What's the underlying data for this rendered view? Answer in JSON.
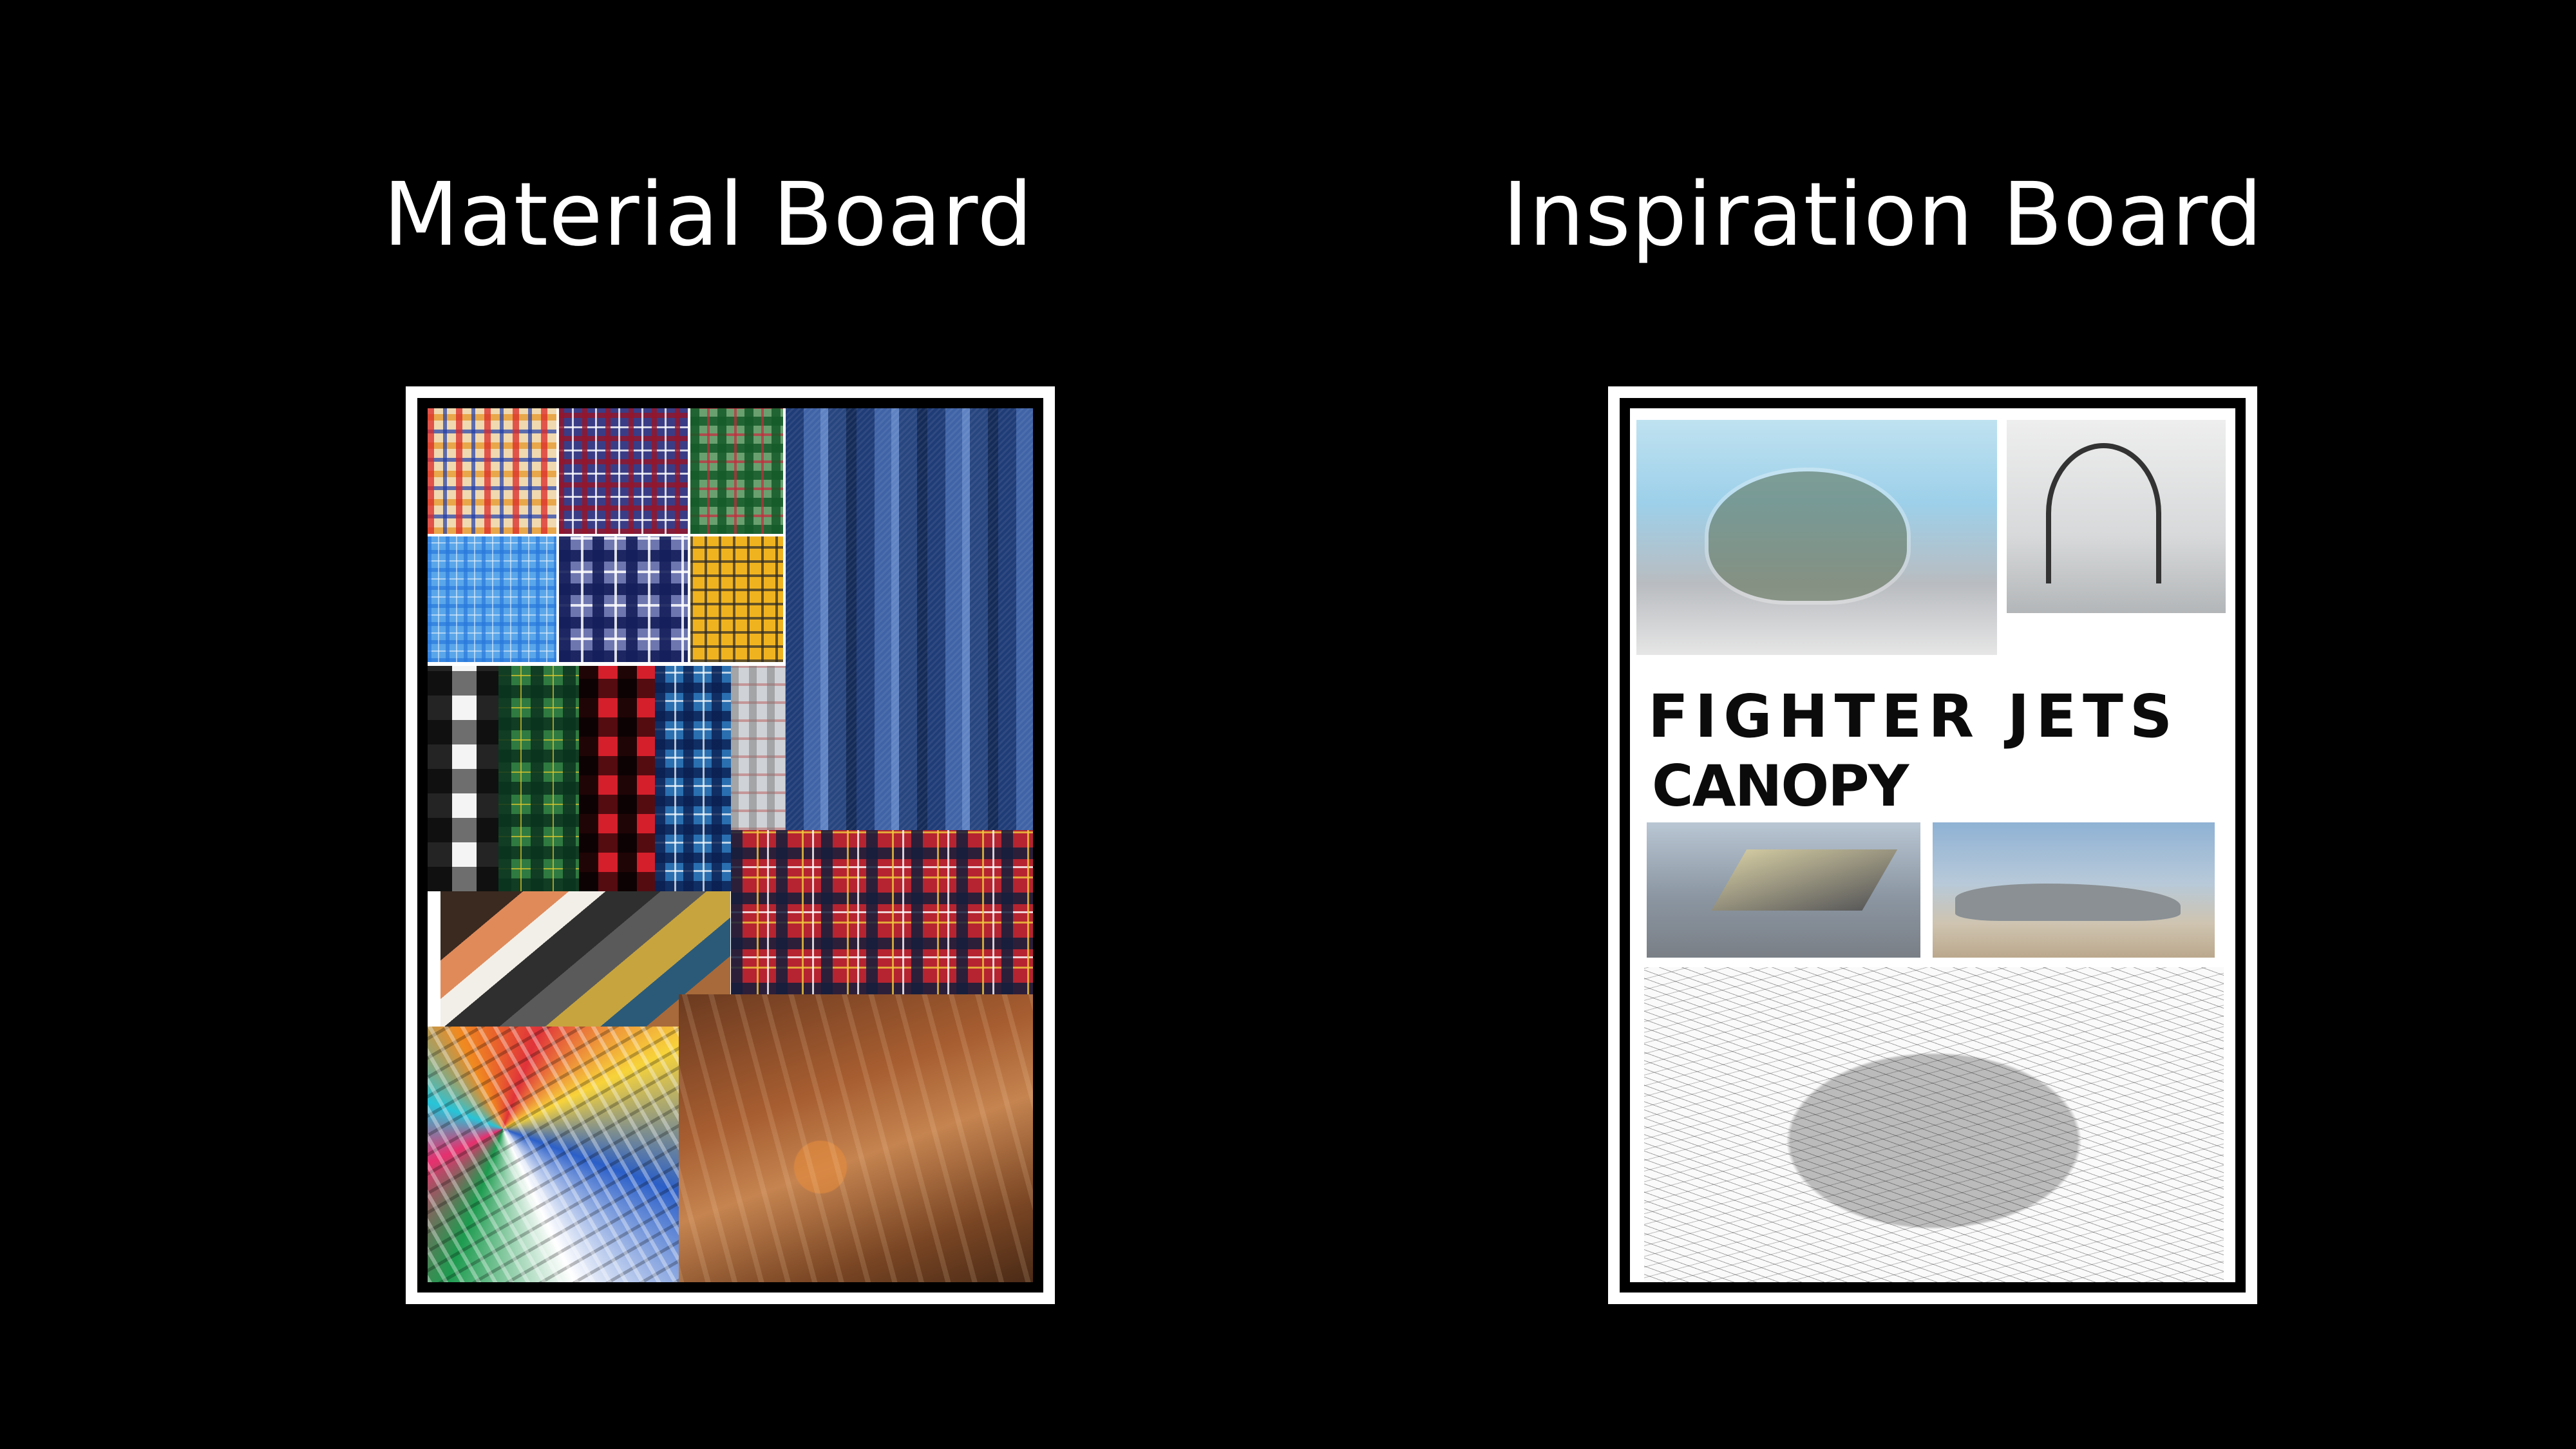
{
  "material_board": {
    "title": "Material Board"
  },
  "inspiration_board": {
    "title": "Inspiration Board",
    "headline": "FIGHTER JETS",
    "subheadline": "CANOPY"
  },
  "colors": {
    "background": "#000000",
    "frame": "#ffffff",
    "text": "#ffffff"
  }
}
